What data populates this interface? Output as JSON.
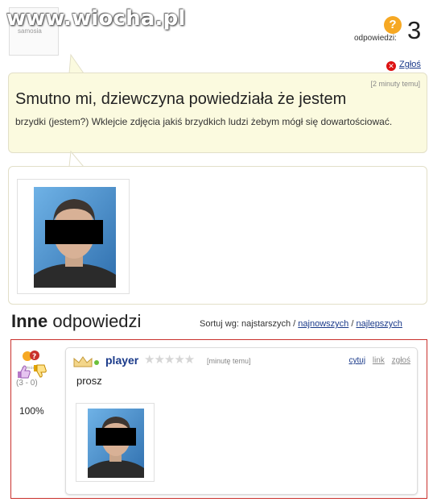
{
  "header": {
    "watermark": "www.wiocha.pl",
    "avatar_logo": "samosia",
    "answers_icon": "?",
    "answers_label": "odpowiedzi:",
    "answers_count": "3",
    "report_label": "Zgłoś"
  },
  "question": {
    "time": "[2 minuty temu]",
    "title": "Smutno mi, dziewczyna powiedziała że jestem",
    "body": "brzydki (jestem?) Wklejcie zdjęcia jakiś brzydkich ludzi żebym mógł się dowartościować."
  },
  "answers_section": {
    "heading_bold": "Inne",
    "heading_rest": "odpowiedzi",
    "sort_prefix": "Sortuj wg: najstarszych /",
    "sort_newest": "najnowszych",
    "sort_sep": "/",
    "sort_best": "najlepszych"
  },
  "answer": {
    "user": "player",
    "stars": "★★★★★",
    "time": "[minutę temu]",
    "link_quote": "cytuj",
    "link_link": "link",
    "link_report": "zgłoś",
    "text": "prosz",
    "votes": "(3 - 0)",
    "percent": "100%"
  },
  "colors": {
    "question_bg": "#fbfadf",
    "link": "#1a3a8a",
    "answer_border": "#c9302c",
    "answers_icon": "#f6a823"
  }
}
